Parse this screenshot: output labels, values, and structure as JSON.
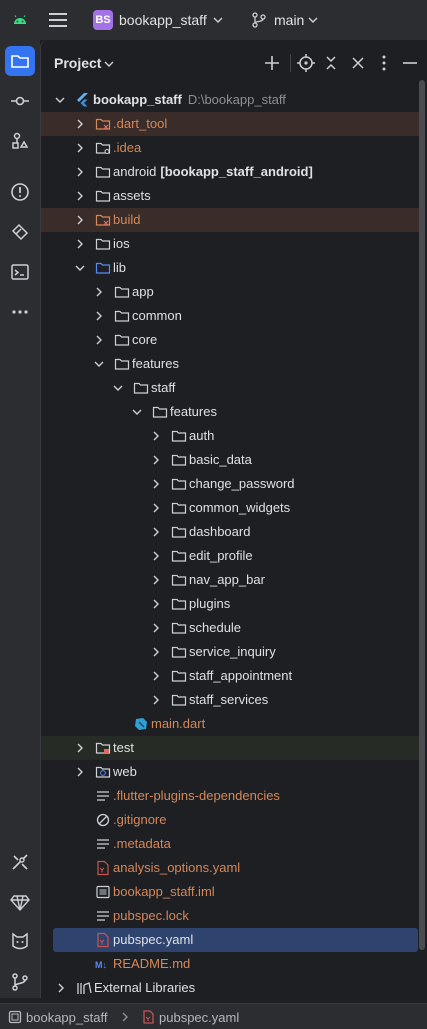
{
  "topbar": {
    "project_badge": "BS",
    "project_name": "bookapp_staff",
    "branch": "main"
  },
  "panel": {
    "title": "Project"
  },
  "tree": [
    {
      "label": "bookapp_staff",
      "hint": "D:\\bookapp_staff",
      "icon": "flutter-icon",
      "level": 0,
      "open": true,
      "bold": true
    },
    {
      "label": ".dart_tool",
      "icon": "folder-excluded-icon",
      "level": 1,
      "open": false,
      "color": "orange",
      "bg": "orange"
    },
    {
      "label": ".idea",
      "icon": "folder-settings-icon",
      "level": 1,
      "open": false,
      "color": "orange"
    },
    {
      "label": "android",
      "module": "[bookapp_staff_android]",
      "icon": "folder-icon",
      "level": 1,
      "open": false
    },
    {
      "label": "assets",
      "icon": "folder-icon",
      "level": 1,
      "open": false
    },
    {
      "label": "build",
      "icon": "folder-excluded-icon",
      "level": 1,
      "open": false,
      "color": "orange",
      "bg": "orange"
    },
    {
      "label": "ios",
      "icon": "folder-icon",
      "level": 1,
      "open": false
    },
    {
      "label": "lib",
      "icon": "folder-source-icon",
      "level": 1,
      "open": true
    },
    {
      "label": "app",
      "icon": "folder-icon",
      "level": 2,
      "open": false
    },
    {
      "label": "common",
      "icon": "folder-icon",
      "level": 2,
      "open": false
    },
    {
      "label": "core",
      "icon": "folder-icon",
      "level": 2,
      "open": false
    },
    {
      "label": "features",
      "icon": "folder-icon",
      "level": 2,
      "open": true
    },
    {
      "label": "staff",
      "icon": "folder-icon",
      "level": 3,
      "open": true
    },
    {
      "label": "features",
      "icon": "folder-icon",
      "level": 4,
      "open": true
    },
    {
      "label": "auth",
      "icon": "folder-icon",
      "level": 5,
      "open": false
    },
    {
      "label": "basic_data",
      "icon": "folder-icon",
      "level": 5,
      "open": false
    },
    {
      "label": "change_password",
      "icon": "folder-icon",
      "level": 5,
      "open": false
    },
    {
      "label": "common_widgets",
      "icon": "folder-icon",
      "level": 5,
      "open": false
    },
    {
      "label": "dashboard",
      "icon": "folder-icon",
      "level": 5,
      "open": false
    },
    {
      "label": "edit_profile",
      "icon": "folder-icon",
      "level": 5,
      "open": false
    },
    {
      "label": "nav_app_bar",
      "icon": "folder-icon",
      "level": 5,
      "open": false
    },
    {
      "label": "plugins",
      "icon": "folder-icon",
      "level": 5,
      "open": false
    },
    {
      "label": "schedule",
      "icon": "folder-icon",
      "level": 5,
      "open": false
    },
    {
      "label": "service_inquiry",
      "icon": "folder-icon",
      "level": 5,
      "open": false
    },
    {
      "label": "staff_appointment",
      "icon": "folder-icon",
      "level": 5,
      "open": false
    },
    {
      "label": "staff_services",
      "icon": "folder-icon",
      "level": 5,
      "open": false
    },
    {
      "label": "main.dart",
      "icon": "dart-file-icon",
      "level": 3,
      "leaf": true,
      "color": "orange"
    },
    {
      "label": "test",
      "icon": "folder-test-icon",
      "level": 1,
      "open": false,
      "bg": "green"
    },
    {
      "label": "web",
      "icon": "folder-web-icon",
      "level": 1,
      "open": false
    },
    {
      "label": ".flutter-plugins-dependencies",
      "icon": "text-file-icon",
      "level": 1,
      "leaf": true,
      "color": "orange"
    },
    {
      "label": ".gitignore",
      "icon": "ignore-file-icon",
      "level": 1,
      "leaf": true,
      "color": "orange"
    },
    {
      "label": ".metadata",
      "icon": "text-file-icon",
      "level": 1,
      "leaf": true,
      "color": "orange"
    },
    {
      "label": "analysis_options.yaml",
      "icon": "yaml-file-icon",
      "level": 1,
      "leaf": true,
      "color": "orange"
    },
    {
      "label": "bookapp_staff.iml",
      "icon": "iml-file-icon",
      "level": 1,
      "leaf": true,
      "color": "orange"
    },
    {
      "label": "pubspec.lock",
      "icon": "text-file-icon",
      "level": 1,
      "leaf": true,
      "color": "orange"
    },
    {
      "label": "pubspec.yaml",
      "icon": "yaml-file-icon",
      "level": 1,
      "leaf": true,
      "selected": true
    },
    {
      "label": "README.md",
      "icon": "markdown-file-icon",
      "level": 1,
      "leaf": true,
      "color": "orange"
    },
    {
      "label": "External Libraries",
      "icon": "library-icon",
      "level": 0,
      "open": false
    }
  ],
  "status": {
    "crumb_project": "bookapp_staff",
    "crumb_file": "pubspec.yaml"
  },
  "colors": {
    "accent": "#3574f0",
    "orange_text": "#d5885a",
    "selection": "#2e436e"
  }
}
